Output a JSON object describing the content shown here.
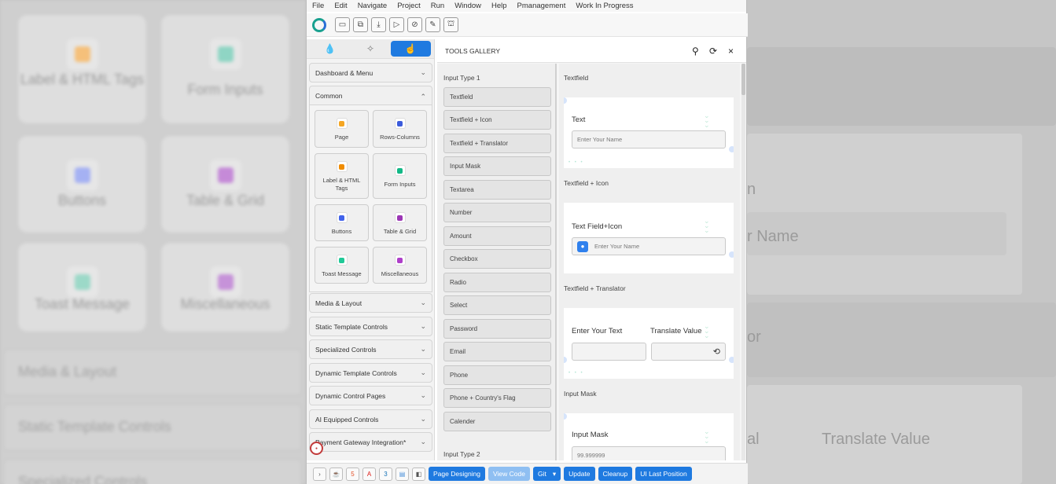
{
  "menu": [
    "File",
    "Edit",
    "Navigate",
    "Project",
    "Run",
    "Window",
    "Help",
    "Pmanagement",
    "Work In Progress"
  ],
  "toolbar": {
    "icons": [
      "save-icon",
      "copy-icon",
      "download-icon",
      "play-icon",
      "stop-icon",
      "edit-icon",
      "deploy-icon"
    ]
  },
  "sidebar": {
    "tabs": [
      "drop-icon",
      "puzzle-icon",
      "hand-pointer-icon"
    ],
    "sections_before": [
      "Dashboard & Menu"
    ],
    "common": {
      "label": "Common",
      "items": [
        {
          "label": "Page",
          "color": "#f5a623"
        },
        {
          "label": "Rows-Columns",
          "color": "#3b5bdb"
        },
        {
          "label": "Label & HTML Tags",
          "color": "#f08c00"
        },
        {
          "label": "Form Inputs",
          "color": "#12b886"
        },
        {
          "label": "Buttons",
          "color": "#4263eb"
        },
        {
          "label": "Table & Grid",
          "color": "#9c36b5"
        },
        {
          "label": "Toast Message",
          "color": "#20c997"
        },
        {
          "label": "Miscellaneous",
          "color": "#ae3ec9"
        }
      ]
    },
    "sections_after": [
      "Media & Layout",
      "Static Template Controls",
      "Specialized Controls",
      "Dynamic Template Controls",
      "Dynamic Control Pages",
      "AI Equipped Controls",
      "Payment Gateway Integration*"
    ]
  },
  "gallery": {
    "title": "TOOLS GALLERY",
    "section1": "Input Type 1",
    "items": [
      "Textfield",
      "Textfield + Icon",
      "Textfield + Translator",
      "Input Mask",
      "Textarea",
      "Number",
      "Amount",
      "Checkbox",
      "Radio",
      "Select",
      "Password",
      "Email",
      "Phone",
      "Phone + Country's Flag",
      "Calender"
    ],
    "section2": "Input Type 2",
    "previews": {
      "textfield": {
        "title": "Textfield",
        "label": "Text",
        "placeholder": "Enter Your Name"
      },
      "textfield_icon": {
        "title": "Textfield + Icon",
        "label": "Text Field+Icon",
        "placeholder": "Enter Your Name"
      },
      "translator": {
        "title": "Textfield + Translator",
        "label1": "Enter Your Text",
        "label2": "Translate Value"
      },
      "input_mask": {
        "title": "Input Mask",
        "label": "Input Mask",
        "placeholder": "99.999999"
      }
    }
  },
  "bottombar": {
    "buttons": [
      "Page Designing",
      "View Code",
      "Git",
      "Update",
      "Cleanup",
      "UI Last Position"
    ],
    "git_caret": "▾"
  },
  "backdrop": {
    "cards": [
      "Label & HTML Tags",
      "Form Inputs",
      "Buttons",
      "Table & Grid",
      "Toast Message",
      "Miscellaneous"
    ],
    "rows": [
      "Media & Layout",
      "Static Template Controls",
      "Specialized Controls"
    ],
    "right_texts": [
      "n",
      "r Name",
      "or",
      "al",
      "Translate Value"
    ]
  }
}
